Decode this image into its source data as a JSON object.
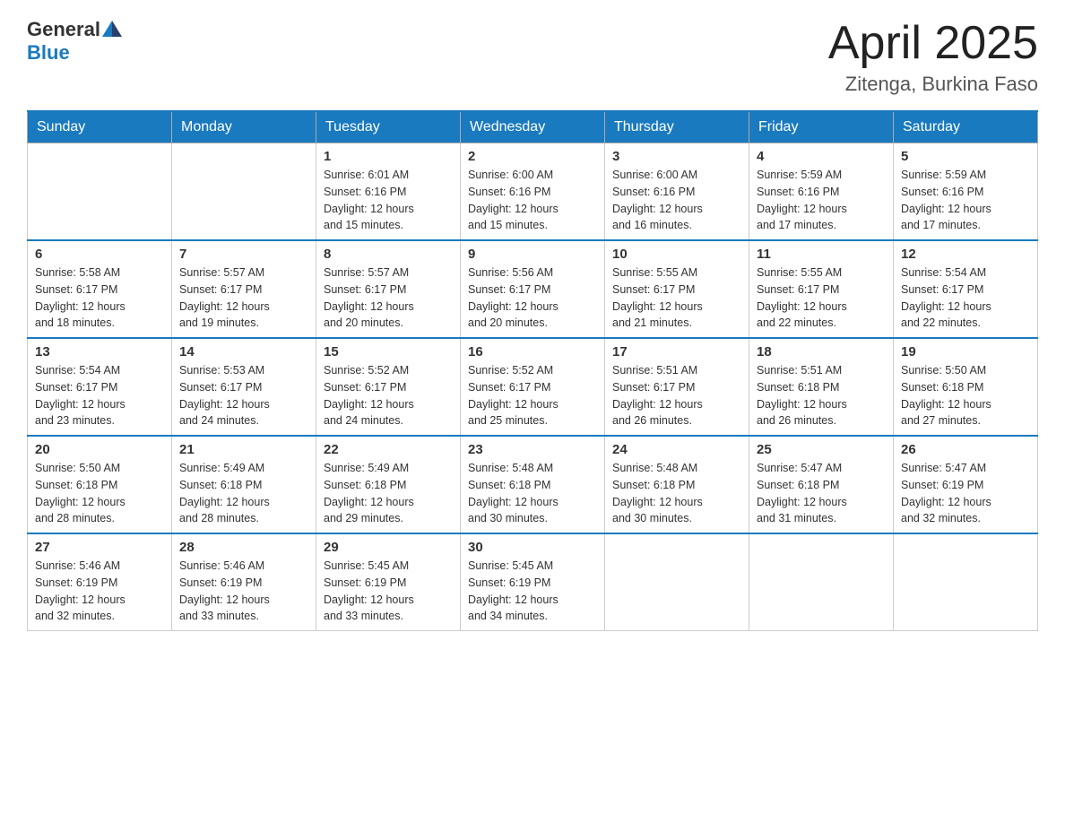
{
  "header": {
    "logo_general": "General",
    "logo_blue": "Blue",
    "month_title": "April 2025",
    "location": "Zitenga, Burkina Faso"
  },
  "weekdays": [
    "Sunday",
    "Monday",
    "Tuesday",
    "Wednesday",
    "Thursday",
    "Friday",
    "Saturday"
  ],
  "weeks": [
    [
      {
        "day": "",
        "info": ""
      },
      {
        "day": "",
        "info": ""
      },
      {
        "day": "1",
        "info": "Sunrise: 6:01 AM\nSunset: 6:16 PM\nDaylight: 12 hours\nand 15 minutes."
      },
      {
        "day": "2",
        "info": "Sunrise: 6:00 AM\nSunset: 6:16 PM\nDaylight: 12 hours\nand 15 minutes."
      },
      {
        "day": "3",
        "info": "Sunrise: 6:00 AM\nSunset: 6:16 PM\nDaylight: 12 hours\nand 16 minutes."
      },
      {
        "day": "4",
        "info": "Sunrise: 5:59 AM\nSunset: 6:16 PM\nDaylight: 12 hours\nand 17 minutes."
      },
      {
        "day": "5",
        "info": "Sunrise: 5:59 AM\nSunset: 6:16 PM\nDaylight: 12 hours\nand 17 minutes."
      }
    ],
    [
      {
        "day": "6",
        "info": "Sunrise: 5:58 AM\nSunset: 6:17 PM\nDaylight: 12 hours\nand 18 minutes."
      },
      {
        "day": "7",
        "info": "Sunrise: 5:57 AM\nSunset: 6:17 PM\nDaylight: 12 hours\nand 19 minutes."
      },
      {
        "day": "8",
        "info": "Sunrise: 5:57 AM\nSunset: 6:17 PM\nDaylight: 12 hours\nand 20 minutes."
      },
      {
        "day": "9",
        "info": "Sunrise: 5:56 AM\nSunset: 6:17 PM\nDaylight: 12 hours\nand 20 minutes."
      },
      {
        "day": "10",
        "info": "Sunrise: 5:55 AM\nSunset: 6:17 PM\nDaylight: 12 hours\nand 21 minutes."
      },
      {
        "day": "11",
        "info": "Sunrise: 5:55 AM\nSunset: 6:17 PM\nDaylight: 12 hours\nand 22 minutes."
      },
      {
        "day": "12",
        "info": "Sunrise: 5:54 AM\nSunset: 6:17 PM\nDaylight: 12 hours\nand 22 minutes."
      }
    ],
    [
      {
        "day": "13",
        "info": "Sunrise: 5:54 AM\nSunset: 6:17 PM\nDaylight: 12 hours\nand 23 minutes."
      },
      {
        "day": "14",
        "info": "Sunrise: 5:53 AM\nSunset: 6:17 PM\nDaylight: 12 hours\nand 24 minutes."
      },
      {
        "day": "15",
        "info": "Sunrise: 5:52 AM\nSunset: 6:17 PM\nDaylight: 12 hours\nand 24 minutes."
      },
      {
        "day": "16",
        "info": "Sunrise: 5:52 AM\nSunset: 6:17 PM\nDaylight: 12 hours\nand 25 minutes."
      },
      {
        "day": "17",
        "info": "Sunrise: 5:51 AM\nSunset: 6:17 PM\nDaylight: 12 hours\nand 26 minutes."
      },
      {
        "day": "18",
        "info": "Sunrise: 5:51 AM\nSunset: 6:18 PM\nDaylight: 12 hours\nand 26 minutes."
      },
      {
        "day": "19",
        "info": "Sunrise: 5:50 AM\nSunset: 6:18 PM\nDaylight: 12 hours\nand 27 minutes."
      }
    ],
    [
      {
        "day": "20",
        "info": "Sunrise: 5:50 AM\nSunset: 6:18 PM\nDaylight: 12 hours\nand 28 minutes."
      },
      {
        "day": "21",
        "info": "Sunrise: 5:49 AM\nSunset: 6:18 PM\nDaylight: 12 hours\nand 28 minutes."
      },
      {
        "day": "22",
        "info": "Sunrise: 5:49 AM\nSunset: 6:18 PM\nDaylight: 12 hours\nand 29 minutes."
      },
      {
        "day": "23",
        "info": "Sunrise: 5:48 AM\nSunset: 6:18 PM\nDaylight: 12 hours\nand 30 minutes."
      },
      {
        "day": "24",
        "info": "Sunrise: 5:48 AM\nSunset: 6:18 PM\nDaylight: 12 hours\nand 30 minutes."
      },
      {
        "day": "25",
        "info": "Sunrise: 5:47 AM\nSunset: 6:18 PM\nDaylight: 12 hours\nand 31 minutes."
      },
      {
        "day": "26",
        "info": "Sunrise: 5:47 AM\nSunset: 6:19 PM\nDaylight: 12 hours\nand 32 minutes."
      }
    ],
    [
      {
        "day": "27",
        "info": "Sunrise: 5:46 AM\nSunset: 6:19 PM\nDaylight: 12 hours\nand 32 minutes."
      },
      {
        "day": "28",
        "info": "Sunrise: 5:46 AM\nSunset: 6:19 PM\nDaylight: 12 hours\nand 33 minutes."
      },
      {
        "day": "29",
        "info": "Sunrise: 5:45 AM\nSunset: 6:19 PM\nDaylight: 12 hours\nand 33 minutes."
      },
      {
        "day": "30",
        "info": "Sunrise: 5:45 AM\nSunset: 6:19 PM\nDaylight: 12 hours\nand 34 minutes."
      },
      {
        "day": "",
        "info": ""
      },
      {
        "day": "",
        "info": ""
      },
      {
        "day": "",
        "info": ""
      }
    ]
  ]
}
